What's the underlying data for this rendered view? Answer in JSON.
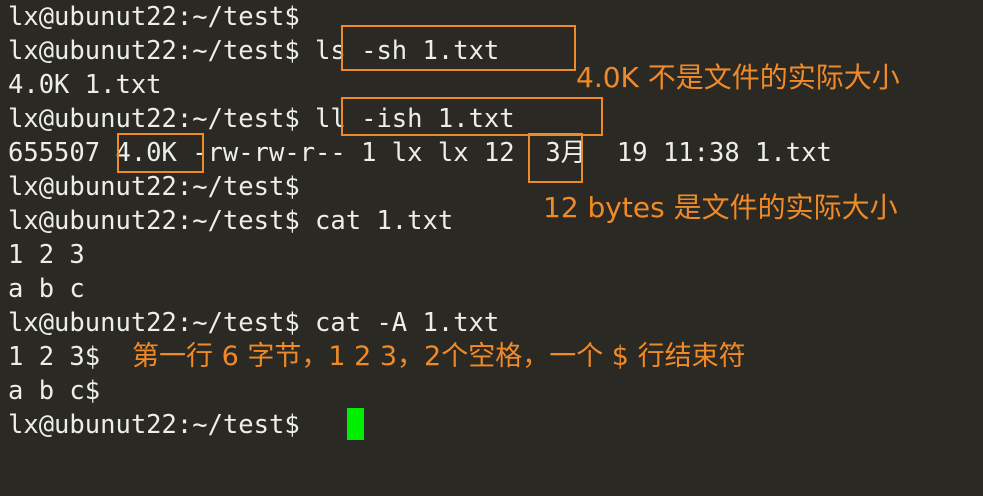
{
  "terminal": {
    "lines": [
      "lx@ubunut22:~/test$",
      "lx@ubunut22:~/test$ ls -sh 1.txt",
      "4.0K 1.txt",
      "lx@ubunut22:~/test$ ll -ish 1.txt",
      "655507 4.0K -rw-rw-r-- 1 lx lx 12  3月  19 11:38 1.txt",
      "lx@ubunut22:~/test$",
      "lx@ubunut22:~/test$ cat 1.txt",
      "1 2 3",
      "a b c",
      "lx@ubunut22:~/test$ cat -A 1.txt",
      "1 2 3$",
      "a b c$",
      "lx@ubunut22:~/test$ "
    ]
  },
  "annotations": {
    "note_size": "4.0K 不是文件的实际大小",
    "note_bytes": "12 bytes 是文件的实际大小",
    "note_line": "第一行 6 字节，1 2 3，2个空格，一个 $ 行结束符"
  },
  "colors": {
    "background": "#2b2923",
    "text": "#ededea",
    "annotation": "#f08a28",
    "cursor": "#00ee00"
  }
}
